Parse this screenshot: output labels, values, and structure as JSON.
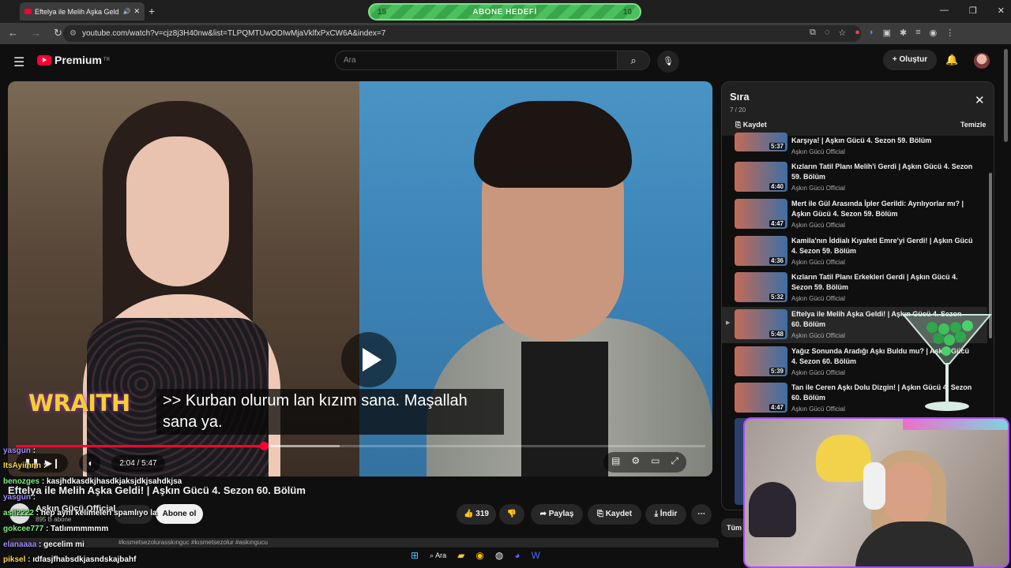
{
  "browser": {
    "tab_title": "Eftelya ile Melih Aşka Geldi!",
    "tab_close": "✕",
    "new_tab": "+",
    "url": "youtube.com/watch?v=cjz8j3H40nw&list=TLPQMTUwODIwMjaVklfxPxCW6A&index=7",
    "window_controls": [
      "—",
      "❐",
      "✕"
    ]
  },
  "goal_overlay": {
    "left": "15",
    "label": "ABONE HEDEFİ",
    "right": "10"
  },
  "youtube": {
    "logo_text": "Premium",
    "logo_sup": "TR",
    "search_placeholder": "Ara",
    "create_label": "+ Oluştur"
  },
  "video": {
    "caption_line1": ">> Kurban olurum lan kızım sana. Maşallah",
    "caption_line2": "sana ya.",
    "overlay_logo": "WRAITH",
    "time": "2:04 / 5:47",
    "progress": 0.36,
    "buffered": 0.47
  },
  "under_video": {
    "title": "Eftelya ile Melih Aşka Geldi! | Aşkın Gücü 4. Sezon 60. Bölüm",
    "channel": "Aşkın Gücü Official",
    "subs": "895 B abone",
    "subscribe": "Abone ol",
    "likes": "319",
    "share": "Paylaş",
    "save": "Kaydet",
    "download": "İndir",
    "more": "⋯",
    "description_tags": "#kısmetsezolurasskınguc #kısmetsezolur #askıngucu"
  },
  "chat": [
    {
      "user": "yasgun",
      "msg": ":",
      "color": "u2"
    },
    {
      "user": "ItsAyiinnn",
      "msg": ":",
      "color": "u3"
    },
    {
      "user": "benozges",
      "msg": ": kasjhdkasdkjhasdkjaksjdkjsahdkjsa",
      "color": "u"
    },
    {
      "user": "yasgun",
      "msg": ":",
      "color": "u2"
    },
    {
      "user": "asil2222",
      "msg": ": hep aynı kelimeleri spamlıyo la",
      "color": "u"
    },
    {
      "user": "gokcee777",
      "msg": ": Tatlımmmmmm",
      "color": "u"
    },
    {
      "user": "elanaaaa",
      "msg": ": gecelim mi",
      "color": "u2"
    },
    {
      "user": "piksel",
      "msg": ": ıdfasjfhabsdkjasndskajbahf",
      "color": "u3"
    }
  ],
  "playlist": {
    "title": "Sıra",
    "count": "7 / 20",
    "save": "Kaydet",
    "clear": "Temizle",
    "items": [
      {
        "title": "Karşıya! | Aşkın Gücü 4. Sezon 59. Bölüm",
        "channel": "Aşkın Gücü Official",
        "duration": "5:37"
      },
      {
        "title": "Kızların Tatil Planı Melih'i Gerdi | Aşkın Gücü 4. Sezon 59. Bölüm",
        "channel": "Aşkın Gücü Official",
        "duration": "4:40"
      },
      {
        "title": "Mert ile Gül Arasında İpler Gerildi: Ayrılıyorlar mı? | Aşkın Gücü 4. Sezon 59. Bölüm",
        "channel": "Aşkın Gücü Official",
        "duration": "4:47"
      },
      {
        "title": "Kamila'nın İddialı Kıyafeti Emre'yi Gerdi! | Aşkın Gücü 4. Sezon 59. Bölüm",
        "channel": "Aşkın Gücü Official",
        "duration": "4:36"
      },
      {
        "title": "Kızların Tatil Planı Erkekleri Gerdi | Aşkın Gücü 4. Sezon 59. Bölüm",
        "channel": "Aşkın Gücü Official",
        "duration": "5:32"
      },
      {
        "title": "Eftelya ile Melih Aşka Geldi! | Aşkın Gücü 4. Sezon 60. Bölüm",
        "channel": "Aşkın Gücü Official",
        "duration": "5:48",
        "active": true
      },
      {
        "title": "Yağız Sonunda Aradığı Aşkı Buldu mu? | Aşkın Gücü 4. Sezon 60. Bölüm",
        "channel": "Aşkın Gücü Official",
        "duration": "5:39"
      },
      {
        "title": "Tan ile Ceren Aşkı Dolu Dizgin! | Aşkın Gücü 4. Sezon 60. Bölüm",
        "channel": "Aşkın Gücü Official",
        "duration": "4:47"
      }
    ],
    "all_button": "Tüm"
  },
  "taskbar": {
    "search": "Ara"
  }
}
